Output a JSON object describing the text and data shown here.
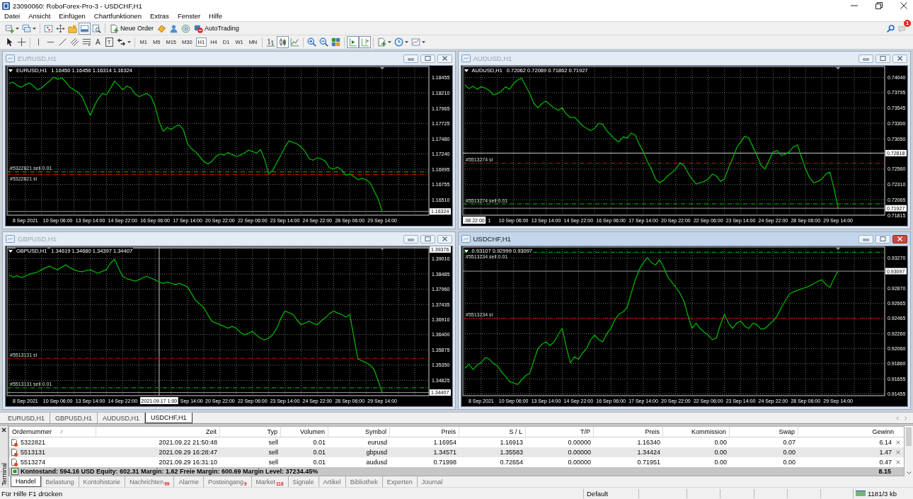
{
  "window": {
    "title": "23090060: RoboForex-Pro-3 - USDCHF,H1"
  },
  "menu": [
    "Datei",
    "Ansicht",
    "Einfügen",
    "Chartfunktionen",
    "Extras",
    "Fenster",
    "Hilfe"
  ],
  "toolbar": {
    "buttons": [
      {
        "kind": "new-chart",
        "pressed": false,
        "dropdown": true
      },
      {
        "kind": "profiles",
        "pressed": false,
        "dropdown": true
      },
      {
        "kind": "separator"
      },
      {
        "kind": "market-watch",
        "pressed": false
      },
      {
        "kind": "data-window",
        "pressed": false
      },
      {
        "kind": "navigator",
        "pressed": false
      },
      {
        "kind": "terminal",
        "pressed": true
      },
      {
        "kind": "tester",
        "pressed": false
      },
      {
        "kind": "separator"
      },
      {
        "kind": "new-order",
        "label": "Neue Order",
        "pressed": false
      },
      {
        "kind": "editor",
        "pressed": false
      },
      {
        "kind": "signals",
        "pressed": false
      },
      {
        "kind": "community",
        "pressed": false
      },
      {
        "kind": "autotrading",
        "label": "AutoTrading",
        "pressed": false
      }
    ],
    "notifications": "1"
  },
  "toolbar2": {
    "drawing_tools": [
      {
        "kind": "cursor"
      },
      {
        "kind": "crosshair"
      },
      {
        "kind": "separator"
      },
      {
        "kind": "vertical-line"
      },
      {
        "kind": "horizontal-line"
      },
      {
        "kind": "trend-line"
      },
      {
        "kind": "channel"
      },
      {
        "kind": "fibonacci"
      },
      {
        "kind": "text",
        "glyph": "A"
      },
      {
        "kind": "label",
        "glyph": "T"
      },
      {
        "kind": "arrows",
        "dropdown": true
      }
    ],
    "timeframes": [
      {
        "label": "M1",
        "selected": false
      },
      {
        "label": "M5",
        "selected": false
      },
      {
        "label": "M15",
        "selected": false
      },
      {
        "label": "M30",
        "selected": false
      },
      {
        "label": "H1",
        "selected": true
      },
      {
        "label": "H4",
        "selected": false
      },
      {
        "label": "D1",
        "selected": false
      },
      {
        "label": "W1",
        "selected": false
      },
      {
        "label": "MN",
        "selected": false
      }
    ],
    "chart_tools": [
      {
        "kind": "bar-chart",
        "pressed": false
      },
      {
        "kind": "candlestick",
        "pressed": true
      },
      {
        "kind": "line-chart",
        "pressed": false
      },
      {
        "kind": "separator"
      },
      {
        "kind": "zoom-in",
        "pressed": false
      },
      {
        "kind": "zoom-out",
        "pressed": false
      },
      {
        "kind": "tile",
        "pressed": false
      },
      {
        "kind": "separator"
      },
      {
        "kind": "autoscroll",
        "pressed": true
      },
      {
        "kind": "chart-shift",
        "pressed": true
      },
      {
        "kind": "separator"
      },
      {
        "kind": "indicators",
        "pressed": false,
        "dropdown": true
      },
      {
        "kind": "periods",
        "pressed": false,
        "dropdown": true
      },
      {
        "kind": "templates",
        "pressed": false,
        "dropdown": true
      }
    ]
  },
  "charts": [
    {
      "title": "EURUSD,H1",
      "active": false,
      "header": {
        "symbol": "EURUSD,H1",
        "prices": "1.16450 1.16456 1.16314 1.16324"
      },
      "chart_data": {
        "type": "line",
        "grid": true,
        "color": "#00b000",
        "categories": [
          null,
          null,
          null,
          null,
          "8 Sep 2021",
          null,
          null,
          null,
          null,
          null,
          null,
          null,
          "10 Sep 06:00",
          null,
          null,
          null,
          null,
          null,
          null,
          null,
          "13 Sep 14:00",
          null,
          null,
          null,
          null,
          null,
          null,
          null,
          "14 Sep 22:00",
          null,
          null,
          null,
          null,
          null,
          null,
          null,
          "16 Sep 06:00",
          null,
          null,
          null,
          null,
          null,
          null,
          null,
          "17 Sep 14:00",
          null,
          null,
          null,
          null,
          null,
          null,
          null,
          "20 Sep 22:00",
          null,
          null,
          null,
          null,
          null,
          null,
          null,
          "22 Sep 06:00",
          null,
          null,
          null,
          null,
          null,
          null,
          null,
          "23 Sep 14:00",
          null,
          null,
          null,
          null,
          null,
          null,
          null,
          "24 Sep 22:00",
          null,
          null,
          null,
          null,
          null,
          null,
          null,
          "28 Sep 06:00",
          null,
          null,
          null,
          null,
          null,
          null,
          null,
          "29 Sep 14:00",
          null,
          null,
          null,
          null,
          null,
          null,
          null,
          null,
          null,
          null,
          null
        ],
        "values": [
          1.1836,
          1.1838,
          1.1833,
          1.183,
          1.1834,
          1.1837,
          1.1832,
          1.1826,
          1.1829,
          1.1835,
          1.184,
          1.1846,
          1.1843,
          1.1845,
          1.1838,
          1.183,
          1.1826,
          1.1822,
          1.1815,
          1.18,
          1.1785,
          1.18,
          1.1812,
          1.182,
          1.1818,
          1.1828,
          1.184,
          1.1833,
          1.1826,
          1.1832,
          1.1829,
          1.182,
          1.1815,
          1.1818,
          1.182,
          1.1815,
          1.18,
          1.1775,
          1.176,
          1.1766,
          1.1763,
          1.1768,
          1.177,
          1.1762,
          1.174,
          1.1732,
          1.1727,
          1.172,
          1.1712,
          1.1708,
          1.1712,
          1.172,
          1.1724,
          1.1722,
          1.1726,
          1.1723,
          1.172,
          1.1722,
          1.1725,
          1.173,
          1.1728,
          1.1725,
          1.1731,
          1.1715,
          1.1692,
          1.1698,
          1.171,
          1.1722,
          1.1735,
          1.1745,
          1.1742,
          1.174,
          1.1735,
          1.1728,
          1.1716,
          1.1714,
          1.1718,
          1.1716,
          1.1712,
          1.1702,
          1.17,
          1.1703,
          1.1698,
          1.169,
          1.1692,
          1.1688,
          1.1683,
          1.1685,
          1.1683,
          1.1678,
          1.1665,
          1.1652,
          1.1632,
          null,
          null,
          null,
          null,
          null,
          null,
          null,
          null,
          null,
          null,
          null
        ],
        "ylim": [
          1.16265,
          1.1863
        ],
        "yticks": [
          {
            "value": 1.18455,
            "label": "1.18455"
          },
          {
            "value": 1.1821,
            "label": "1.18210"
          },
          {
            "value": 1.17965,
            "label": "1.17965"
          },
          {
            "value": 1.17725,
            "label": "1.17725"
          },
          {
            "value": 1.1748,
            "label": "1.17480"
          },
          {
            "value": 1.1724,
            "label": "1.17240"
          },
          {
            "value": 1.16995,
            "label": "1.16995"
          },
          {
            "value": 1.16755,
            "label": "1.16755"
          },
          {
            "value": 1.1651,
            "label": "1.16510"
          }
        ],
        "ref_lines": [
          {
            "axis": "y",
            "value": 1.16954,
            "label": "#5322821 sell 0.01",
            "color": "#00c000",
            "line_style": "dashdot"
          },
          {
            "axis": "y",
            "value": 1.16913,
            "label": "#5322821 sl",
            "color": "#e00000",
            "line_style": "dashdot"
          },
          {
            "axis": "y",
            "value": 1.16324,
            "label": "1.16324",
            "color": "#a0a0a0",
            "line_style": "solid"
          }
        ]
      }
    },
    {
      "title": "AUDUSD,H1",
      "active": false,
      "header": {
        "symbol": "AUDUSD,H1",
        "prices": "0.72062 0.72089 0.71862 0.71927"
      },
      "chart_data": {
        "type": "line",
        "grid": true,
        "color": "#00b000",
        "categories": [
          null,
          null,
          null,
          null,
          null,
          null,
          "1",
          null,
          null,
          null,
          null,
          null,
          "10 Sep 06:00",
          null,
          null,
          null,
          null,
          null,
          null,
          null,
          "13 Sep 14:00",
          null,
          null,
          null,
          null,
          null,
          null,
          null,
          "14 Sep 22:00",
          null,
          null,
          null,
          null,
          null,
          null,
          null,
          "16 Sep 06:00",
          null,
          null,
          null,
          null,
          null,
          null,
          null,
          "17 Sep 14:00",
          null,
          null,
          null,
          null,
          null,
          null,
          null,
          "20 Sep 22:00",
          null,
          null,
          null,
          null,
          null,
          null,
          null,
          "22 Sep 06:00",
          null,
          null,
          null,
          null,
          null,
          null,
          null,
          "23 Sep 14:00",
          null,
          null,
          null,
          null,
          null,
          null,
          null,
          "24 Sep 22:00",
          null,
          null,
          null,
          null,
          null,
          null,
          null,
          "28 Sep 06:00",
          null,
          null,
          null,
          null,
          null,
          null,
          null,
          "29 Sep 14:00",
          null,
          null,
          null,
          null,
          null,
          null,
          null,
          null,
          null,
          null,
          null
        ],
        "values": [
          0.7392,
          0.7386,
          0.739,
          0.7385,
          0.7389,
          0.7387,
          0.7383,
          0.7376,
          0.7378,
          0.7382,
          0.7389,
          0.7385,
          0.7394,
          0.74,
          0.7403,
          0.739,
          0.7378,
          0.7362,
          0.7355,
          0.7362,
          0.7366,
          0.736,
          0.7355,
          0.7351,
          0.7355,
          0.7345,
          0.7339,
          0.734,
          0.7333,
          0.7326,
          0.7322,
          0.7318,
          0.7322,
          0.733,
          0.7328,
          0.7318,
          0.7311,
          0.7304,
          0.73,
          0.7308,
          0.7306,
          0.7314,
          0.7311,
          0.7296,
          0.7284,
          0.7268,
          0.7256,
          0.724,
          0.7234,
          0.7238,
          0.7245,
          0.725,
          0.7256,
          0.7266,
          0.7262,
          0.725,
          0.724,
          0.7232,
          0.7234,
          0.7236,
          0.724,
          0.7248,
          0.7245,
          0.7236,
          0.724,
          0.7258,
          0.7273,
          0.729,
          0.73,
          0.7309,
          0.7306,
          0.7292,
          0.7278,
          0.7262,
          0.7256,
          0.727,
          0.7284,
          0.7286,
          0.7278,
          0.728,
          0.7284,
          0.7292,
          0.7295,
          0.7275,
          0.7256,
          0.7242,
          0.7234,
          0.7236,
          0.724,
          0.7248,
          0.7251,
          0.7225,
          0.7193,
          null,
          null,
          null,
          null,
          null,
          null,
          null,
          null,
          null,
          null,
          null
        ],
        "ylim": [
          0.71815,
          0.74217
        ],
        "yticks": [
          {
            "value": 0.7404,
            "label": "0.74040"
          },
          {
            "value": 0.73795,
            "label": "0.73795"
          },
          {
            "value": 0.73545,
            "label": "0.73545"
          },
          {
            "value": 0.733,
            "label": "0.73300"
          },
          {
            "value": 0.7305,
            "label": "0.73050"
          },
          {
            "value": 0.7256,
            "label": "0.72560"
          },
          {
            "value": 0.7231,
            "label": "0.72310"
          },
          {
            "value": 0.72065,
            "label": "0.72065"
          },
          {
            "value": 0.71815,
            "label": "0.71815"
          }
        ],
        "ref_lines": [
          {
            "axis": "y",
            "value": 0.72818,
            "label": "0.72818",
            "color": "#d0d0d0",
            "line_style": "solid"
          },
          {
            "axis": "y",
            "value": 0.72654,
            "label": "#5513274 sl",
            "color": "#e00000",
            "line_style": "dashdot"
          },
          {
            "axis": "y",
            "value": 0.71998,
            "label": "#5513274 sell 0.01",
            "color": "#00c000",
            "line_style": "dashdot"
          },
          {
            "axis": "y",
            "value": 0.71927,
            "label": "0.71927",
            "color": "#a0a0a0",
            "line_style": "solid"
          }
        ],
        "annotations": [
          ".08 22:00"
        ]
      }
    },
    {
      "title": "GBPUSD,H1",
      "active": false,
      "header": {
        "symbol": "GBPUSD,H1",
        "prices": "1.34619 1.34680 1.34397 1.34407"
      },
      "chart_data": {
        "type": "line",
        "grid": true,
        "color": "#00b000",
        "categories": [
          null,
          null,
          null,
          null,
          "8 Sep 2021",
          null,
          null,
          null,
          null,
          null,
          null,
          null,
          "10 Sep 06:00",
          null,
          null,
          null,
          null,
          null,
          null,
          null,
          "13 Sep 14:00",
          null,
          null,
          null,
          null,
          null,
          null,
          null,
          "14 Sep 22:00",
          null,
          null,
          null,
          null,
          null,
          null,
          null,
          null,
          "2021.09.17 1:00",
          null,
          null,
          null,
          null,
          null,
          null,
          null,
          "Sep 14:00",
          null,
          null,
          null,
          null,
          null,
          null,
          "20 Sep 22:00",
          null,
          null,
          null,
          null,
          null,
          null,
          null,
          "22 Sep 06:00",
          null,
          null,
          null,
          null,
          null,
          null,
          null,
          "23 Sep 14:00",
          null,
          null,
          null,
          null,
          null,
          null,
          null,
          "24 Sep 22:00",
          null,
          null,
          null,
          null,
          null,
          null,
          null,
          "28 Sep 06:00",
          null,
          null,
          null,
          null,
          null,
          null,
          null,
          "29 Sep 14:00",
          null,
          null,
          null,
          null,
          null,
          null,
          null,
          null,
          null,
          null,
          null
        ],
        "values": [
          1.3845,
          1.3838,
          1.3842,
          1.3836,
          1.384,
          1.3848,
          1.3851,
          1.3855,
          1.3863,
          1.387,
          1.3875,
          1.3868,
          1.3863,
          1.3872,
          1.388,
          1.387,
          1.3863,
          1.3858,
          1.3856,
          1.386,
          1.3863,
          1.3856,
          1.3851,
          1.3858,
          1.3863,
          1.3885,
          1.3899,
          1.3868,
          1.384,
          1.3832,
          1.3828,
          1.3824,
          1.3828,
          1.3836,
          1.384,
          1.3834,
          1.3828,
          1.382,
          1.3816,
          1.382,
          1.3816,
          1.3812,
          1.3816,
          1.381,
          1.3804,
          1.378,
          1.3757,
          1.3745,
          1.3733,
          1.3708,
          1.3686,
          1.368,
          1.3674,
          1.3668,
          1.3662,
          1.3668,
          1.3662,
          1.3648,
          1.3639,
          1.3645,
          1.3651,
          1.3638,
          1.3627,
          1.3622,
          1.3627,
          1.364,
          1.3662,
          1.3695,
          1.3721,
          1.3715,
          1.3709,
          1.369,
          1.3674,
          1.368,
          1.3686,
          1.3678,
          1.3674,
          1.3688,
          1.3698,
          1.3712,
          1.3721,
          1.3714,
          1.3709,
          1.37,
          1.3709,
          1.363,
          1.3556,
          1.355,
          1.3544,
          1.3535,
          1.352,
          1.348,
          1.3441,
          null,
          null,
          null,
          null,
          null,
          null,
          null,
          null,
          null,
          null,
          null
        ],
        "ylim": [
          1.343,
          1.3941
        ],
        "yticks": [
          {
            "value": 1.3901,
            "label": "1.39010"
          },
          {
            "value": 1.38485,
            "label": "1.38485"
          },
          {
            "value": 1.3796,
            "label": "1.37960"
          },
          {
            "value": 1.37435,
            "label": "1.37435"
          },
          {
            "value": 1.3691,
            "label": "1.36910"
          },
          {
            "value": 1.364,
            "label": "1.36400"
          },
          {
            "value": 1.35875,
            "label": "1.35875"
          },
          {
            "value": 1.3535,
            "label": "1.35350"
          },
          {
            "value": 1.34825,
            "label": "1.34825"
          }
        ],
        "ref_lines": [
          {
            "axis": "y",
            "value": 1.39376,
            "label": "1.39376",
            "color": "#c8c8c8",
            "line_style": "solid"
          },
          {
            "axis": "x",
            "value": "2021.09.17 1:00",
            "color": "#c8c8c8",
            "line_style": "solid"
          },
          {
            "axis": "y",
            "value": 1.35583,
            "label": "#5513131 sl",
            "color": "#e00000",
            "line_style": "dashdot"
          },
          {
            "axis": "y",
            "value": 1.34571,
            "label": "#5513131 sell 0.01",
            "color": "#00c000",
            "line_style": "dashdot"
          },
          {
            "axis": "y",
            "value": 1.34407,
            "label": "1.34407",
            "color": "#a0a0a0",
            "line_style": "solid"
          }
        ]
      }
    },
    {
      "title": "USDCHF,H1",
      "active": true,
      "header": {
        "prices": "0.93107 0.92999 0.93097"
      },
      "chart_data": {
        "type": "line",
        "grid": true,
        "color": "#00b000",
        "categories": [
          null,
          null,
          null,
          null,
          "8 Sep 2021",
          null,
          null,
          null,
          null,
          null,
          null,
          null,
          "10 Sep 06:00",
          null,
          null,
          null,
          null,
          null,
          null,
          null,
          "13 Sep 14:00",
          null,
          null,
          null,
          null,
          null,
          null,
          null,
          "14 Sep 22:00",
          null,
          null,
          null,
          null,
          null,
          null,
          null,
          "16 Sep 06:00",
          null,
          null,
          null,
          null,
          null,
          null,
          null,
          "17 Sep 14:00",
          null,
          null,
          null,
          null,
          null,
          null,
          null,
          "20 Sep 22:00",
          null,
          null,
          null,
          null,
          null,
          null,
          null,
          "22 Sep 06:00",
          null,
          null,
          null,
          null,
          null,
          null,
          null,
          "23 Sep 14:00",
          null,
          null,
          null,
          null,
          null,
          null,
          null,
          "24 Sep 22:00",
          null,
          null,
          null,
          null,
          null,
          null,
          null,
          "28 Sep 06:00",
          null,
          null,
          null,
          null,
          null,
          null,
          null,
          "29 Sep 14:00",
          null,
          null,
          null,
          null,
          null,
          null,
          null,
          null,
          null,
          null,
          null
        ],
        "values": [
          0.918,
          0.9185,
          0.9178,
          0.9184,
          0.9187,
          0.9194,
          0.9192,
          0.9186,
          0.9183,
          0.9175,
          0.9169,
          0.9162,
          0.916,
          0.9158,
          0.9164,
          0.917,
          0.9173,
          0.919,
          0.9206,
          0.9212,
          0.9215,
          0.921,
          0.9215,
          0.9225,
          0.9233,
          0.9208,
          0.9187,
          0.9195,
          0.9192,
          0.92,
          0.9206,
          0.9218,
          0.9224,
          0.9218,
          0.9215,
          0.9226,
          0.9233,
          0.9245,
          0.9252,
          0.9255,
          0.9261,
          0.928,
          0.9298,
          0.9312,
          0.9321,
          0.9328,
          0.9321,
          0.9318,
          0.9325,
          0.9315,
          0.9302,
          0.9295,
          0.9288,
          0.928,
          0.927,
          0.925,
          0.9233,
          0.924,
          0.9233,
          0.9228,
          0.9224,
          0.9218,
          0.922,
          0.9238,
          0.9252,
          0.924,
          0.9233,
          0.924,
          0.9243,
          0.9236,
          0.9233,
          0.924,
          0.9238,
          0.9232,
          0.9233,
          0.9238,
          0.9243,
          0.925,
          0.9261,
          0.927,
          0.9279,
          0.9282,
          0.9284,
          0.9286,
          0.9288,
          0.929,
          0.9293,
          0.9296,
          0.9298,
          0.9292,
          0.9288,
          0.93,
          0.931,
          null,
          null,
          null,
          null,
          null,
          null,
          null,
          null,
          null,
          null,
          null
        ],
        "ylim": [
          0.9143,
          0.9342
        ],
        "yticks": [
          {
            "value": 0.9327,
            "label": "0.93270"
          },
          {
            "value": 0.9287,
            "label": "0.92870"
          },
          {
            "value": 0.92665,
            "label": "0.92665"
          },
          {
            "value": 0.92465,
            "label": "0.92465"
          },
          {
            "value": 0.9226,
            "label": "0.92260"
          },
          {
            "value": 0.9206,
            "label": "0.92060"
          },
          {
            "value": 0.9186,
            "label": "0.91860"
          },
          {
            "value": 0.91655,
            "label": "0.91655"
          },
          {
            "value": 0.91455,
            "label": "0.91455"
          }
        ],
        "ref_lines": [
          {
            "axis": "y",
            "value": 0.9335,
            "label": "#5513234 sell 0.01",
            "color": "#00c000",
            "line_style": "dashdot"
          },
          {
            "axis": "y",
            "value": 0.92465,
            "label": "#5513234 sl",
            "color": "#e00000",
            "line_style": "dashdot"
          },
          {
            "axis": "y",
            "value": 0.93097,
            "label": "0.93097",
            "color": "#a0a0a0",
            "line_style": "solid"
          }
        ]
      }
    }
  ],
  "chart_tabs": [
    {
      "label": "EURUSD,H1",
      "selected": false
    },
    {
      "label": "GBPUSD,H1",
      "selected": false
    },
    {
      "label": "AUDUSD,H1",
      "selected": false
    },
    {
      "label": "USDCHF,H1",
      "selected": true
    }
  ],
  "terminal": {
    "title": "Terminal",
    "columns": [
      "Ordernummer",
      "Zeit",
      "Typ",
      "Volumen",
      "Symbol",
      "Preis",
      "S / L",
      "T/P",
      "Preis",
      "Kommission",
      "Swap",
      "Gewinn"
    ],
    "rows": [
      [
        "5322821",
        "2021.09.22 21:50:48",
        "sell",
        "0.01",
        "eurusd",
        "1.16954",
        "1.16913",
        "0.00000",
        "1.16340",
        "0.00",
        "0.07",
        "6.14"
      ],
      [
        "5513131",
        "2021.09.29 16:28:47",
        "sell",
        "0.01",
        "gbpusd",
        "1.34571",
        "1.35583",
        "0.00000",
        "1.34424",
        "0.00",
        "0.00",
        "1.47"
      ],
      [
        "5513274",
        "2021.09.29 16:31:10",
        "sell",
        "0.01",
        "audusd",
        "0.71998",
        "0.72654",
        "0.00000",
        "0.71951",
        "0.00",
        "0.00",
        "0.47"
      ]
    ],
    "summary": {
      "text": "Kontostand: 594.16 USD  Equity: 602.31  Margin: 1.62  Freie Margin: 600.69  Margin Level: 37234.45%",
      "profit": "8.15"
    },
    "tabs": [
      {
        "label": "Handel",
        "selected": true
      },
      {
        "label": "Belastung",
        "selected": false
      },
      {
        "label": "Kontohistorie",
        "selected": false
      },
      {
        "label": "Nachrichten",
        "badge": "99",
        "selected": false
      },
      {
        "label": "Alarme",
        "selected": false
      },
      {
        "label": "Posteingang",
        "badge": "9",
        "selected": false
      },
      {
        "label": "Market",
        "badge": "118",
        "selected": false
      },
      {
        "label": "Signale",
        "selected": false
      },
      {
        "label": "Artikel",
        "selected": false
      },
      {
        "label": "Bibliothek",
        "selected": false
      },
      {
        "label": "Experten",
        "selected": false
      },
      {
        "label": "Journal",
        "selected": false
      }
    ]
  },
  "status_bar": {
    "help": "Für Hilfe F1 drücken",
    "profile": "Default",
    "traffic": "1181/3 kb"
  }
}
